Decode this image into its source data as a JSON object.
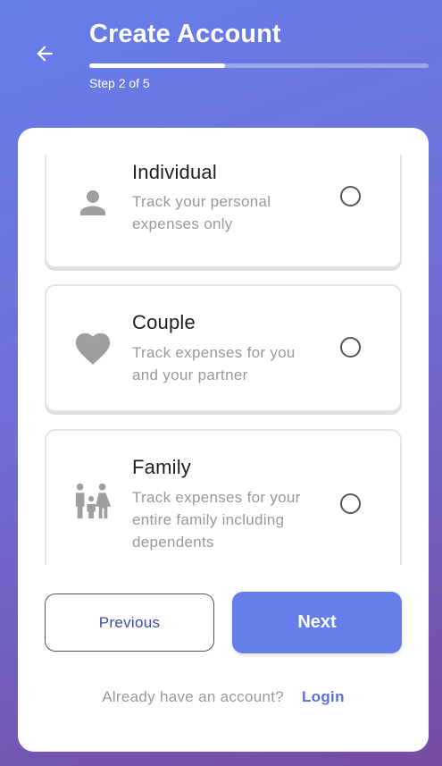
{
  "header": {
    "title": "Create Account",
    "step_text": "Step 2 of 5",
    "progress_fraction": 0.4,
    "back_icon": "arrow-left-icon"
  },
  "options": [
    {
      "id": "individual",
      "title": "Individual",
      "description": "Track your personal expenses only",
      "icon": "person-icon",
      "selected": false
    },
    {
      "id": "couple",
      "title": "Couple",
      "description": "Track expenses for you and your partner",
      "icon": "heart-icon",
      "selected": false
    },
    {
      "id": "family",
      "title": "Family",
      "description": "Track expenses for your entire family including dependents",
      "icon": "family-icon",
      "selected": false
    }
  ],
  "buttons": {
    "previous_label": "Previous",
    "next_label": "Next"
  },
  "footer": {
    "prompt": "Already have an account?",
    "login_label": "Login"
  },
  "colors": {
    "gradient_start": "#667eea",
    "gradient_end": "#764ba2",
    "accent": "#667eea",
    "icon_gray": "#9e9e9e"
  }
}
